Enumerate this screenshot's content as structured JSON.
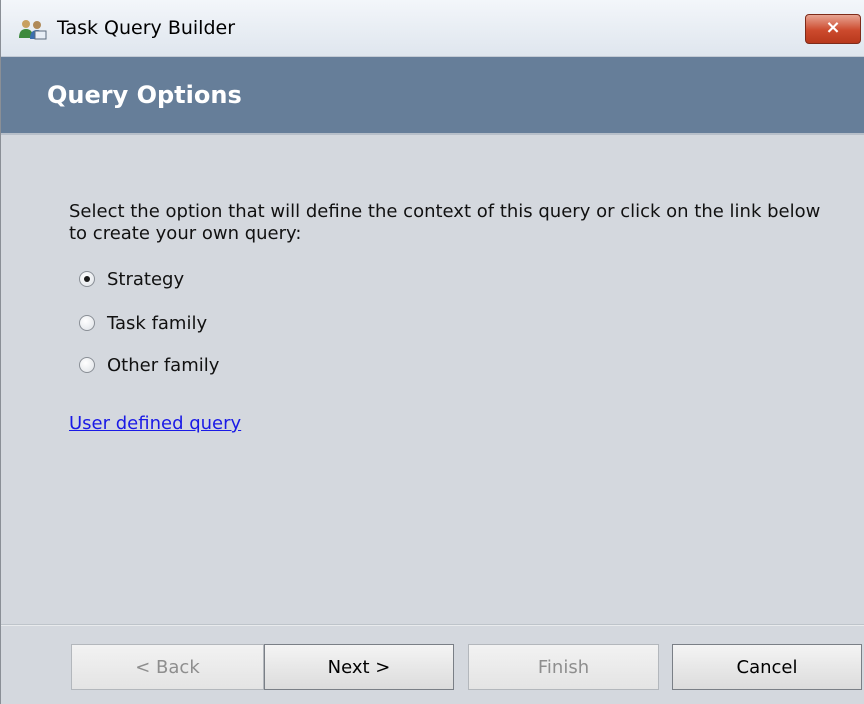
{
  "window": {
    "title": "Task Query Builder",
    "app_icon": "people-icon",
    "close_icon": "close-icon",
    "close_label": "×"
  },
  "header": {
    "title": "Query Options"
  },
  "main": {
    "instructions": "Select the option that will define the context of this query or click on the link below to create your own query:",
    "options": [
      {
        "label": "Strategy",
        "selected": true
      },
      {
        "label": "Task family",
        "selected": false
      },
      {
        "label": "Other family",
        "selected": false
      }
    ],
    "link_label": "User defined query"
  },
  "buttons": {
    "back": "< Back",
    "next": "Next >",
    "finish": "Finish",
    "cancel": "Cancel"
  },
  "colors": {
    "header_band": "#667e99",
    "link": "#1a1ae6",
    "close_button": "#cc4a2d"
  }
}
